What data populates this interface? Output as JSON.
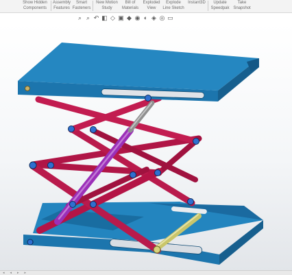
{
  "ribbon": {
    "items": [
      {
        "label": "Show Hidden\nComponents"
      },
      {
        "label": "Assembly\nFeatures"
      },
      {
        "label": "Smart\nFasteners"
      },
      {
        "label": "New Motion\nStudy"
      },
      {
        "label": "Bill of\nMaterials"
      },
      {
        "label": "Exploded\nView"
      },
      {
        "label": "Explode\nLine Sketch"
      },
      {
        "label": "Instant3D"
      },
      {
        "label": "Update\nSpeedpak"
      },
      {
        "label": "Take\nSnapshot"
      }
    ]
  },
  "view_toolbar": {
    "icons": [
      "zoom-to-fit-icon",
      "zoom-area-icon",
      "previous-view-icon",
      "section-view-icon",
      "dynamic-annotation-icon",
      "view-orientation-icon",
      "display-style-icon",
      "hide-show-icon",
      "edit-appearance-icon",
      "apply-scene-icon",
      "view-settings-icon",
      "display-pane-icon"
    ]
  },
  "model": {
    "name": "scissor lift assembly",
    "colors": {
      "platform": "#1f7fb6",
      "platform_dark": "#11547e",
      "scissor": "#b41446",
      "cylinder": "#9b2fb8",
      "rod": "#8f8f8f",
      "pin": "#2f6fd0",
      "roller": "#c9c56a"
    }
  }
}
